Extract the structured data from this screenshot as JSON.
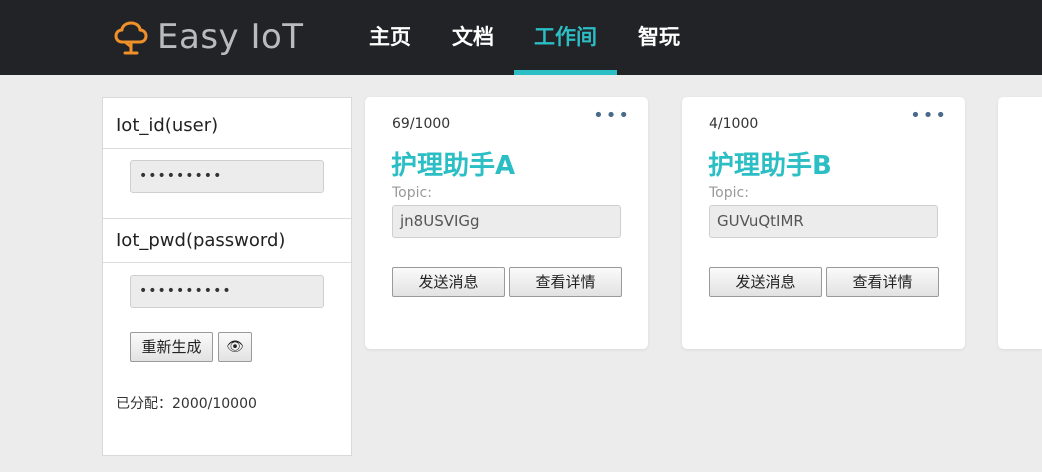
{
  "brand": {
    "name": "Easy IoT",
    "logo_icon": "cloud-tree-icon",
    "logo_color": "#f0902a"
  },
  "nav": {
    "items": [
      {
        "label": "主页",
        "active": false
      },
      {
        "label": "文档",
        "active": false
      },
      {
        "label": "工作间",
        "active": true
      },
      {
        "label": "智玩",
        "active": false
      }
    ],
    "active_color": "#2bbec4"
  },
  "sidebar": {
    "user_label": "Iot_id(user)",
    "user_value": "•••••••••",
    "pwd_label": "Iot_pwd(password)",
    "pwd_value": "••••••••••",
    "regenerate_label": "重新生成",
    "eye_icon": "eye-icon",
    "eye_glyph": "👁",
    "allocated_label": "已分配：",
    "allocated_value": "2000/10000"
  },
  "cards": [
    {
      "count": "69/1000",
      "title": "护理助手A",
      "topic_label": "Topic:",
      "topic_value": "jn8USVIGg",
      "send_label": "发送消息",
      "detail_label": "查看详情",
      "menu_glyph": "•••"
    },
    {
      "count": "4/1000",
      "title": "护理助手B",
      "topic_label": "Topic:",
      "topic_value": "GUVuQtIMR",
      "send_label": "发送消息",
      "detail_label": "查看详情",
      "menu_glyph": "•••"
    }
  ]
}
